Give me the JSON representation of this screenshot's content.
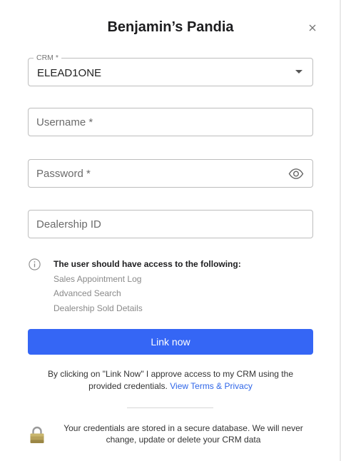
{
  "dialog": {
    "title": "Benjamin’s Pandia"
  },
  "crm": {
    "label": "CRM *",
    "value": "ELEAD1ONE"
  },
  "username": {
    "placeholder": "Username *",
    "value": ""
  },
  "password": {
    "placeholder": "Password *",
    "value": ""
  },
  "dealership": {
    "placeholder": "Dealership ID",
    "value": ""
  },
  "access_info": {
    "title": "The user should have access to the following:",
    "items": [
      "Sales Appointment Log",
      "Advanced Search",
      "Dealership Sold Details"
    ]
  },
  "link_button": {
    "label": "Link now"
  },
  "consent": {
    "text": "By clicking on \"Link Now\" I approve access to my CRM using the provided credentials.",
    "link_label": "View Terms & Privacy"
  },
  "security": {
    "text": "Your credentials are stored in a secure database. We will never change, update or delete your CRM data"
  },
  "colors": {
    "accent": "#3566f5",
    "link": "#2f66e8"
  }
}
